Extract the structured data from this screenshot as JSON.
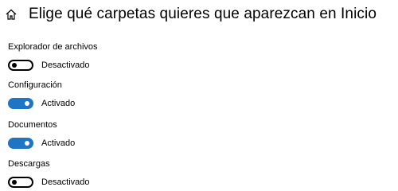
{
  "header": {
    "title": "Elige qué carpetas quieres que aparezcan en Inicio",
    "icon": "home-icon"
  },
  "settings": [
    {
      "label": "Explorador de archivos",
      "state": "Desactivado",
      "on": false
    },
    {
      "label": "Configuración",
      "state": "Activado",
      "on": true
    },
    {
      "label": "Documentos",
      "state": "Activado",
      "on": true
    },
    {
      "label": "Descargas",
      "state": "Desactivado",
      "on": false
    }
  ],
  "colors": {
    "accent": "#1f74c4",
    "off_border": "#000000",
    "background": "#ffffff"
  }
}
